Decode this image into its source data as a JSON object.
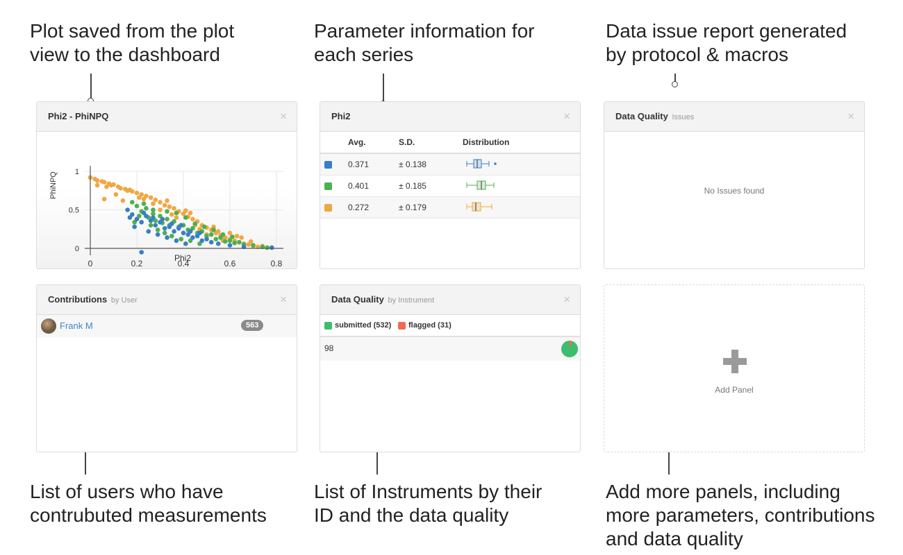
{
  "captions": {
    "plot": "Plot saved from the plot\nview to the dashboard",
    "param": "Parameter information for\neach series",
    "issues": "Data issue report generated\nby protocol & macros",
    "users": "List of users who have\ncontrubuted measurements",
    "instruments": "List of Instruments by their\nID and the data quality",
    "add": "Add more panels, including\nmore parameters, contributions\nand data quality"
  },
  "panels": {
    "plot": {
      "title": "Phi2 - PhiNPQ",
      "close": "×"
    },
    "param": {
      "title": "Phi2",
      "close": "×",
      "columns": [
        "Avg.",
        "S.D.",
        "Distribution"
      ],
      "rows": [
        {
          "avg": "0.371",
          "sd": "± 0.138",
          "color": "#3a7fc1"
        },
        {
          "avg": "0.401",
          "sd": "± 0.185",
          "color": "#4cb050"
        },
        {
          "avg": "0.272",
          "sd": "± 0.179",
          "color": "#f0a742"
        }
      ]
    },
    "issues": {
      "title": "Data Quality",
      "subtitle": "Issues",
      "close": "×",
      "empty": "No Issues found"
    },
    "contrib": {
      "title": "Contributions",
      "subtitle": "by User",
      "close": "×",
      "user": "Frank M",
      "count": "563"
    },
    "instrument": {
      "title": "Data Quality",
      "subtitle": "by Instrument",
      "close": "×",
      "legend_submitted": "submitted (532)",
      "legend_flagged": "flagged (31)",
      "submitted_color": "#3dbd6e",
      "flagged_color": "#f26c4f",
      "instrument_id": "98",
      "submitted": 532,
      "flagged": 31
    },
    "add": {
      "label": "Add Panel"
    }
  },
  "chart_data": {
    "type": "scatter",
    "title": "Phi2 - PhiNPQ",
    "xlabel": "Phi2",
    "ylabel": "PhiNPQ",
    "xlim": [
      0,
      0.8
    ],
    "ylim": [
      0,
      1
    ],
    "xticks": [
      "0",
      "0.2",
      "0.4",
      "0.6",
      "0.8"
    ],
    "yticks": [
      "0",
      "0.5",
      "1"
    ],
    "series": [
      {
        "color": "#f0a742",
        "points": [
          [
            0.0,
            0.92
          ],
          [
            0.02,
            0.9
          ],
          [
            0.03,
            0.88
          ],
          [
            0.05,
            0.87
          ],
          [
            0.06,
            0.86
          ],
          [
            0.08,
            0.84
          ],
          [
            0.09,
            0.82
          ],
          [
            0.1,
            0.83
          ],
          [
            0.12,
            0.8
          ],
          [
            0.13,
            0.78
          ],
          [
            0.15,
            0.77
          ],
          [
            0.16,
            0.75
          ],
          [
            0.18,
            0.74
          ],
          [
            0.2,
            0.72
          ],
          [
            0.22,
            0.7
          ],
          [
            0.24,
            0.68
          ],
          [
            0.26,
            0.66
          ],
          [
            0.28,
            0.63
          ],
          [
            0.3,
            0.6
          ],
          [
            0.32,
            0.56
          ],
          [
            0.34,
            0.54
          ],
          [
            0.36,
            0.52
          ],
          [
            0.38,
            0.48
          ],
          [
            0.4,
            0.45
          ],
          [
            0.42,
            0.41
          ],
          [
            0.44,
            0.38
          ],
          [
            0.46,
            0.35
          ],
          [
            0.48,
            0.3
          ],
          [
            0.5,
            0.27
          ],
          [
            0.52,
            0.24
          ],
          [
            0.54,
            0.2
          ],
          [
            0.56,
            0.17
          ],
          [
            0.58,
            0.14
          ],
          [
            0.6,
            0.12
          ],
          [
            0.62,
            0.1
          ],
          [
            0.64,
            0.08
          ],
          [
            0.66,
            0.06
          ],
          [
            0.68,
            0.05
          ],
          [
            0.7,
            0.03
          ],
          [
            0.72,
            0.02
          ],
          [
            0.06,
            0.64
          ],
          [
            0.11,
            0.7
          ],
          [
            0.14,
            0.62
          ],
          [
            0.21,
            0.66
          ],
          [
            0.27,
            0.58
          ],
          [
            0.3,
            0.5
          ],
          [
            0.35,
            0.44
          ],
          [
            0.41,
            0.49
          ],
          [
            0.45,
            0.3
          ],
          [
            0.5,
            0.18
          ],
          [
            0.55,
            0.22
          ],
          [
            0.6,
            0.2
          ],
          [
            0.65,
            0.14
          ],
          [
            0.03,
            0.82
          ],
          [
            0.07,
            0.8
          ],
          [
            0.17,
            0.76
          ],
          [
            0.23,
            0.64
          ],
          [
            0.33,
            0.62
          ],
          [
            0.37,
            0.4
          ],
          [
            0.43,
            0.46
          ],
          [
            0.47,
            0.25
          ],
          [
            0.53,
            0.28
          ],
          [
            0.57,
            0.1
          ],
          [
            0.63,
            0.16
          ],
          [
            0.69,
            0.09
          ],
          [
            0.74,
            0.03
          ]
        ]
      },
      {
        "color": "#4cb050",
        "points": [
          [
            0.18,
            0.6
          ],
          [
            0.2,
            0.55
          ],
          [
            0.22,
            0.48
          ],
          [
            0.24,
            0.52
          ],
          [
            0.25,
            0.4
          ],
          [
            0.27,
            0.45
          ],
          [
            0.28,
            0.36
          ],
          [
            0.3,
            0.42
          ],
          [
            0.31,
            0.33
          ],
          [
            0.33,
            0.38
          ],
          [
            0.34,
            0.3
          ],
          [
            0.36,
            0.35
          ],
          [
            0.38,
            0.28
          ],
          [
            0.4,
            0.3
          ],
          [
            0.42,
            0.24
          ],
          [
            0.44,
            0.26
          ],
          [
            0.46,
            0.2
          ],
          [
            0.48,
            0.22
          ],
          [
            0.5,
            0.16
          ],
          [
            0.52,
            0.18
          ],
          [
            0.54,
            0.12
          ],
          [
            0.56,
            0.14
          ],
          [
            0.58,
            0.09
          ],
          [
            0.6,
            0.1
          ],
          [
            0.62,
            0.07
          ],
          [
            0.64,
            0.08
          ],
          [
            0.66,
            0.05
          ],
          [
            0.7,
            0.04
          ],
          [
            0.74,
            0.02
          ],
          [
            0.76,
            0.01
          ],
          [
            0.21,
            0.42
          ],
          [
            0.26,
            0.3
          ],
          [
            0.29,
            0.24
          ],
          [
            0.32,
            0.2
          ],
          [
            0.35,
            0.16
          ],
          [
            0.39,
            0.12
          ],
          [
            0.43,
            0.1
          ],
          [
            0.47,
            0.06
          ],
          [
            0.23,
            0.58
          ],
          [
            0.37,
            0.46
          ],
          [
            0.41,
            0.4
          ],
          [
            0.45,
            0.32
          ],
          [
            0.49,
            0.28
          ],
          [
            0.53,
            0.24
          ],
          [
            0.57,
            0.18
          ],
          [
            0.61,
            0.15
          ],
          [
            0.19,
            0.34
          ],
          [
            0.27,
            0.5
          ],
          [
            0.33,
            0.48
          ]
        ]
      },
      {
        "color": "#3a7fc1",
        "points": [
          [
            0.16,
            0.5
          ],
          [
            0.18,
            0.44
          ],
          [
            0.2,
            0.38
          ],
          [
            0.22,
            0.34
          ],
          [
            0.24,
            0.42
          ],
          [
            0.26,
            0.36
          ],
          [
            0.28,
            0.3
          ],
          [
            0.3,
            0.34
          ],
          [
            0.32,
            0.26
          ],
          [
            0.34,
            0.28
          ],
          [
            0.36,
            0.22
          ],
          [
            0.38,
            0.26
          ],
          [
            0.4,
            0.2
          ],
          [
            0.42,
            0.18
          ],
          [
            0.44,
            0.14
          ],
          [
            0.46,
            0.16
          ],
          [
            0.48,
            0.1
          ],
          [
            0.5,
            0.12
          ],
          [
            0.52,
            0.08
          ],
          [
            0.55,
            0.06
          ],
          [
            0.6,
            0.04
          ],
          [
            0.66,
            0.02
          ],
          [
            0.78,
            0.01
          ],
          [
            0.22,
            -0.05
          ],
          [
            0.19,
            0.28
          ],
          [
            0.25,
            0.22
          ],
          [
            0.29,
            0.18
          ],
          [
            0.33,
            0.14
          ],
          [
            0.37,
            0.1
          ],
          [
            0.41,
            0.06
          ],
          [
            0.17,
            0.4
          ],
          [
            0.23,
            0.46
          ],
          [
            0.27,
            0.4
          ],
          [
            0.31,
            0.38
          ],
          [
            0.35,
            0.32
          ],
          [
            0.39,
            0.3
          ],
          [
            0.43,
            0.22
          ],
          [
            0.47,
            0.2
          ]
        ]
      }
    ]
  }
}
